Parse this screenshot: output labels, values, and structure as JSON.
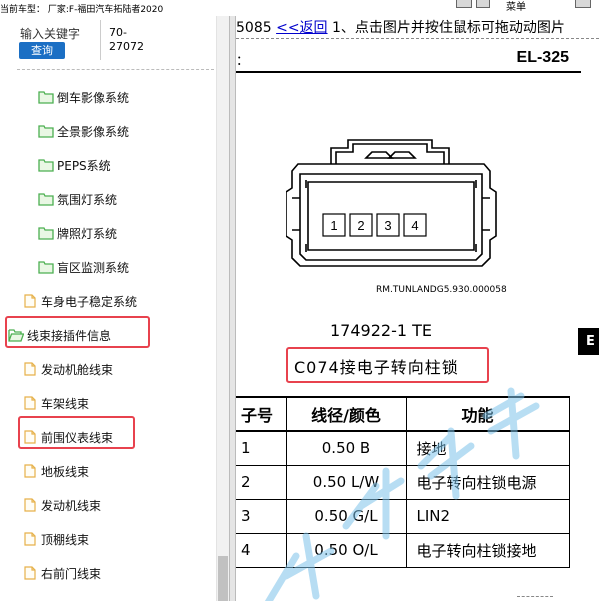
{
  "window": {
    "car_model": "当前车型： 厂家:F-福田汽车拓陆者2020",
    "menu_label": "菜单"
  },
  "search": {
    "label": "输入关键字",
    "button": "查询",
    "code_line1": "70-",
    "code_line2": "27072"
  },
  "tree": {
    "items": [
      {
        "label": "倒车影像系统",
        "icon": "folder-icon"
      },
      {
        "label": "全景影像系统",
        "icon": "folder-icon"
      },
      {
        "label": "PEPS系统",
        "icon": "folder-icon"
      },
      {
        "label": "氛围灯系统",
        "icon": "folder-icon"
      },
      {
        "label": "牌照灯系统",
        "icon": "folder-icon"
      },
      {
        "label": "盲区监测系统",
        "icon": "folder-icon"
      },
      {
        "label": "车身电子稳定系统",
        "icon": "file-icon"
      },
      {
        "label": "线束接插件信息",
        "icon": "folder-open-icon"
      },
      {
        "label": "发动机舱线束",
        "icon": "file-icon"
      },
      {
        "label": "车架线束",
        "icon": "file-icon"
      },
      {
        "label": "前围仪表线束",
        "icon": "file-icon"
      },
      {
        "label": "地板线束",
        "icon": "file-icon"
      },
      {
        "label": "发动机线束",
        "icon": "file-icon"
      },
      {
        "label": "顶棚线束",
        "icon": "file-icon"
      },
      {
        "label": "右前门线束",
        "icon": "file-icon"
      }
    ]
  },
  "document": {
    "nav_prefix": "5085",
    "back_link": "<<返回",
    "instruction": "1、点击图片并按住鼠标可拖动动图片",
    "colon": "：",
    "page_code": "EL-325",
    "connector_pins": [
      "1",
      "2",
      "3",
      "4"
    ],
    "rm_code": "RM.TUNLANDG5.930.000058",
    "part_number": "174922-1 TE",
    "connector_name": "C074接电子转向柱锁",
    "side_box": "E",
    "table": {
      "headers": [
        "子号",
        "线径/颜色",
        "功能"
      ],
      "rows": [
        {
          "pin": "1",
          "wire": "0.50 B",
          "func": "接地"
        },
        {
          "pin": "2",
          "wire": "0.50 L/W",
          "func": "电子转向柱锁电源"
        },
        {
          "pin": "3",
          "wire": "0.50 G/L",
          "func": "LIN2"
        },
        {
          "pin": "4",
          "wire": "0.50 O/L",
          "func": "电子转向柱锁接地"
        }
      ]
    }
  },
  "colors": {
    "highlight": "#e8424e",
    "button": "#1b6fc4",
    "link": "#0000cc",
    "folder": "#4caf50",
    "watermark": "#7ec3ea"
  }
}
